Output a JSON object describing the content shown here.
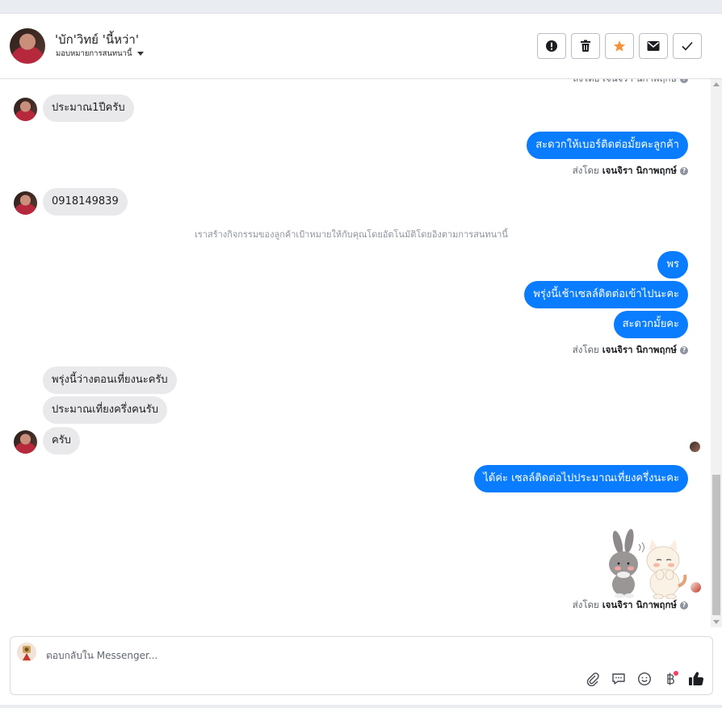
{
  "header": {
    "contact_name": "'บัก'วิทย์ 'นี้หว่า'",
    "assign_label": "มอบหมายการสนทนานี้"
  },
  "toolbar": {
    "buttons": [
      {
        "name": "spam-button",
        "icon": "exclamation-icon"
      },
      {
        "name": "delete-button",
        "icon": "trash-icon"
      },
      {
        "name": "star-button",
        "icon": "star-icon"
      },
      {
        "name": "mark-unread-button",
        "icon": "envelope-icon"
      },
      {
        "name": "done-button",
        "icon": "check-icon"
      }
    ],
    "star_color": "#f7923b"
  },
  "chat": {
    "partial_top_sender": "ส่งโดย เจนจิรา นิกาพฤกษ์",
    "messages": {
      "m1": "ประมาณ1ปีครับ",
      "m2": "สะดวกให้เบอร์ติดต่อมั้ยคะลูกค้า",
      "m3": "0918149839",
      "m4": "พร",
      "m5": "พรุ่งนี้เช้าเซลล์ติดต่อเข้าไปนะคะ",
      "m6": "สะดวกมั้ยคะ",
      "m7": "พรุ่งนี้ว่างตอนเที่ยงนะครับ",
      "m8": "ประมาณเที่ยงครึ่งคนรับ",
      "m9": "ครับ",
      "m10": "ได้ค่ะ เซลล์ติดต่อไปประมาณเที่ยงครึ่งนะคะ"
    },
    "system_note": "เราสร้างกิจกรรมของลูกค้าเป้าหมายให้กับคุณโดยอัตโนมัติโดยอิงตามการสนทนานี้",
    "sent_by_prefix": "ส่งโดย",
    "sent_by_name": "เจนจิรา นิกาพฤกษ์",
    "sticker": "bunny-and-cat-sticker"
  },
  "composer": {
    "placeholder": "ตอบกลับใน Messenger...",
    "icons": [
      "paperclip-icon",
      "saved-reply-icon",
      "emoji-icon",
      "baht-icon",
      "thumbs-up-icon"
    ]
  },
  "colors": {
    "outgoing": "#0a7cff",
    "incoming": "#e9e9eb"
  }
}
